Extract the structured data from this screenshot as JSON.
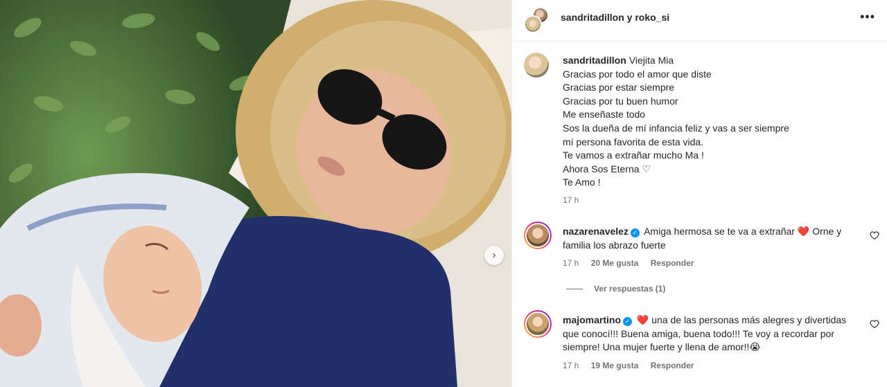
{
  "post": {
    "header_title": "sandritadillon y roko_si",
    "more_icon": "more-horizontal-icon",
    "next_icon": "chevron-right-icon"
  },
  "caption": {
    "username": "sandritadillon",
    "lines": [
      "Viejita Mia",
      "Gracias por todo el amor que diste",
      "Gracias por estar siempre",
      "Gracias por tu buen humor",
      "Me enseñaste todo",
      "Sos la dueña de mí infancia feliz y vas a ser siempre",
      "mí persona favorita de esta vida.",
      "Te vamos a extrañar mucho Ma !",
      "Ahora Sos Eterna ♡",
      "Te Amo !"
    ],
    "time": "17 h"
  },
  "comments": [
    {
      "username": "nazarenavelez",
      "verified_icon": "verified-badge-icon",
      "text_before": "Amiga hermosa se te va a extrañar",
      "emoji": "❤️",
      "text_after": "Orne y familia los abrazo fuerte",
      "time": "17 h",
      "likes": "20 Me gusta",
      "reply_label": "Responder",
      "view_replies": "Ver respuestas (1)"
    },
    {
      "username": "majomartino",
      "verified_icon": "verified-badge-icon",
      "emoji": "❤️",
      "text": "una de las personas más alegres y divertidas que conocí!!! Buena amiga, buena todo!!! Te voy a recordar por siempre! Una mujer fuerte y llena de amor!!😭",
      "time": "17 h",
      "likes": "19 Me gusta",
      "reply_label": "Responder"
    }
  ],
  "colors": {
    "verified": "#0095f6",
    "heart": "#e0245e",
    "muted": "#737373",
    "text": "#262626"
  }
}
